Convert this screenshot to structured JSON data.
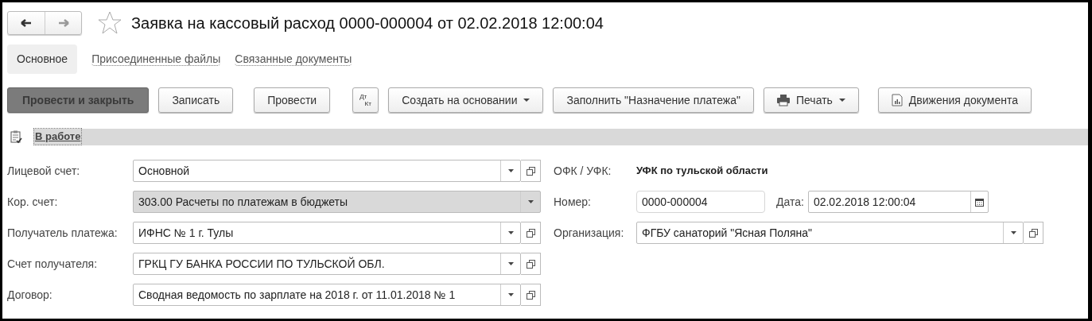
{
  "title": "Заявка на кассовый расход 0000-000004 от 02.02.2018 12:00:04",
  "favorite": false,
  "tabs": [
    {
      "label": "Основное",
      "selected": true
    },
    {
      "label": "Присоединенные файлы",
      "selected": false
    },
    {
      "label": "Связанные документы",
      "selected": false
    }
  ],
  "toolbar": [
    {
      "kind": "primary",
      "label": "Провести и закрыть"
    },
    {
      "kind": "plain",
      "label": "Записать"
    },
    {
      "kind": "plain",
      "label": "Провести"
    },
    {
      "kind": "dtkt",
      "label": "Дт",
      "sublabel": "Кт"
    },
    {
      "kind": "menu",
      "label": "Создать на основании"
    },
    {
      "kind": "plain",
      "label": "Заполнить \"Назначение платежа\""
    },
    {
      "kind": "print",
      "label": "Печать"
    },
    {
      "kind": "report",
      "label": "Движения документа"
    }
  ],
  "status": {
    "link": "В работе"
  },
  "left_fields": [
    {
      "label": "Лицевой счет:",
      "value": "Основной",
      "readonly": false,
      "open_button": true
    },
    {
      "label": "Кор. счет:",
      "value": "303.00 Расчеты по платежам в бюджеты",
      "readonly": true,
      "open_button": false
    },
    {
      "label": "Получатель платежа:",
      "value": "ИФНС № 1 г. Тулы",
      "readonly": false,
      "open_button": true
    },
    {
      "label": "Счет получателя:",
      "value": "ГРКЦ ГУ БАНКА РОССИИ ПО ТУЛЬСКОЙ ОБЛ.",
      "readonly": false,
      "open_button": true
    },
    {
      "label": "Договор:",
      "value": "Сводная ведомость по зарплате на 2018 г. от 11.01.2018 № 1",
      "readonly": false,
      "open_button": true
    }
  ],
  "right_fields": [
    {
      "kind": "text",
      "label": "ОФК / УФК:",
      "value": "УФК по тульской области"
    },
    {
      "kind": "number_date",
      "label": "Номер:",
      "value": "0000-000004",
      "date_label": "Дата:",
      "date_value": "02.02.2018 12:00:04"
    },
    {
      "kind": "select",
      "label": "Организация:",
      "value": "ФГБУ санаторий \"Ясная Поляна\""
    }
  ]
}
